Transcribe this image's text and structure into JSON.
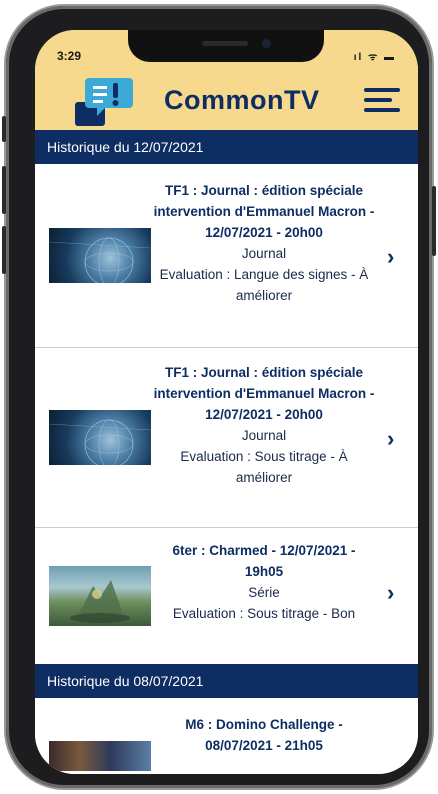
{
  "status_bar": {
    "time": "3:29",
    "icons": "ıl ᯤ ▬"
  },
  "app": {
    "name": "CommonTV"
  },
  "sections": [
    {
      "heading": "Historique du 12/07/2021",
      "entries": [
        {
          "title": "TF1 : Journal : édition spéciale intervention d'Emmanuel Macron - 12/07/2021 - 20h00",
          "genre": "Journal",
          "evaluation": "Evaluation : Langue des signes - À améliorer",
          "thumbnail": "globe"
        },
        {
          "title": "TF1 : Journal : édition spéciale intervention d'Emmanuel Macron - 12/07/2021 - 20h00",
          "genre": "Journal",
          "evaluation": "Evaluation : Sous titrage - À améliorer",
          "thumbnail": "globe"
        },
        {
          "title": "6ter : Charmed - 12/07/2021 - 19h05",
          "genre": "Série",
          "evaluation": "Evaluation : Sous titrage - Bon",
          "thumbnail": "magic-scene"
        }
      ]
    },
    {
      "heading": "Historique du 08/07/2021",
      "entries": [
        {
          "title": "M6 : Domino Challenge - 08/07/2021 - 21h05",
          "thumbnail": "show-scene"
        }
      ]
    }
  ],
  "icons": {
    "menu": "hamburger-menu-icon",
    "chevron": "chevron-right-icon",
    "logo": "chat-logo-icon"
  },
  "colors": {
    "header_bg": "#f7d98d",
    "brand": "#0e2d63",
    "section_bg": "#0e2d63"
  }
}
